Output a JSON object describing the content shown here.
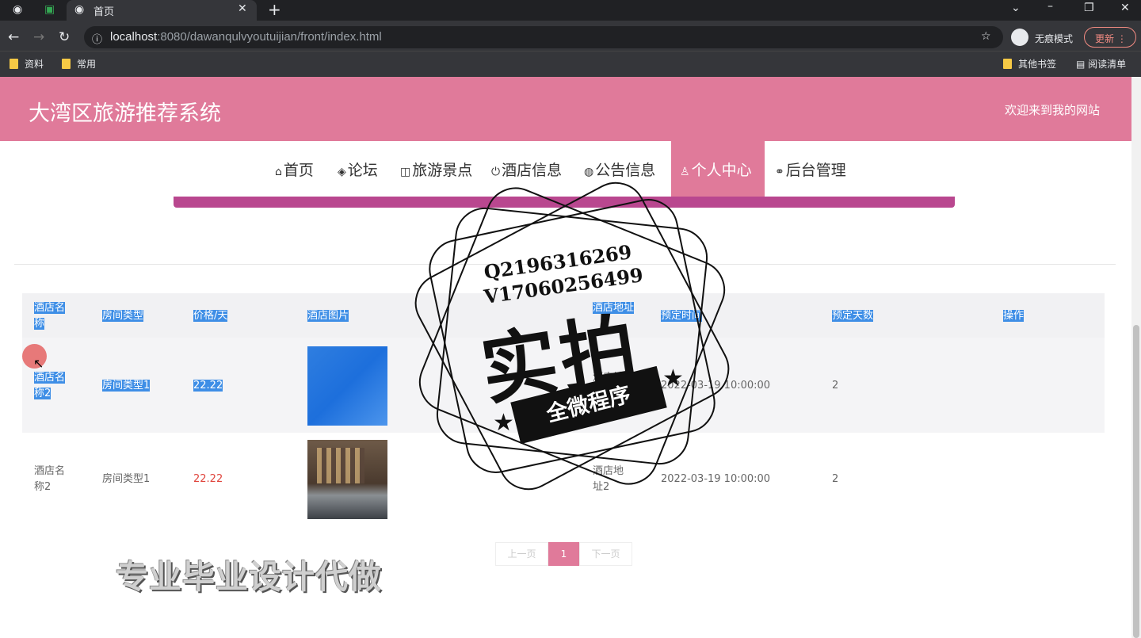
{
  "browser": {
    "tab_title": "首页",
    "url_host": "localhost",
    "url_path": ":8080/dawanqulvyoutuijian/front/index.html",
    "incognito_label": "无痕模式",
    "update_label": "更新",
    "bookmarks": [
      "资料",
      "常用"
    ],
    "bookmarks_right": [
      "其他书签",
      "阅读清单"
    ]
  },
  "site": {
    "title": "大湾区旅游推荐系统",
    "welcome": "欢迎来到我的网站"
  },
  "nav": [
    {
      "label": "首页",
      "icon": "home-icon",
      "glyph": "⌂"
    },
    {
      "label": "论坛",
      "icon": "cube-icon",
      "glyph": "◈"
    },
    {
      "label": "旅游景点",
      "icon": "gift-icon",
      "glyph": "◫"
    },
    {
      "label": "酒店信息",
      "icon": "power-icon",
      "glyph": "⏻"
    },
    {
      "label": "公告信息",
      "icon": "globe-icon",
      "glyph": "◍"
    },
    {
      "label": "个人中心",
      "icon": "user-icon",
      "glyph": "♙"
    },
    {
      "label": "后台管理",
      "icon": "link-icon",
      "glyph": "⚭"
    }
  ],
  "table": {
    "headers": [
      "酒店名称",
      "房间类型",
      "价格/天",
      "酒店图片",
      "酒店地址",
      "预定时间",
      "预定天数",
      "操作"
    ],
    "rows": [
      {
        "hotel": "酒店名称2",
        "room_type": "房间类型1",
        "price": "22.22",
        "address": "酒店地址2",
        "time": "2022-03-19 10:00:00",
        "days": "2"
      },
      {
        "hotel": "酒店名称2",
        "room_type": "房间类型1",
        "price": "22.22",
        "address": "酒店地址2",
        "time": "2022-03-19 10:00:00",
        "days": "2"
      }
    ]
  },
  "pagination": {
    "prev": "上一页",
    "current": "1",
    "next": "下一页"
  },
  "overlay": {
    "promo": "专业毕业设计代做",
    "stamp_q": "Q2196316269",
    "stamp_v": "V17060256499",
    "stamp_big": "实拍",
    "stamp_band": "全微程序"
  }
}
